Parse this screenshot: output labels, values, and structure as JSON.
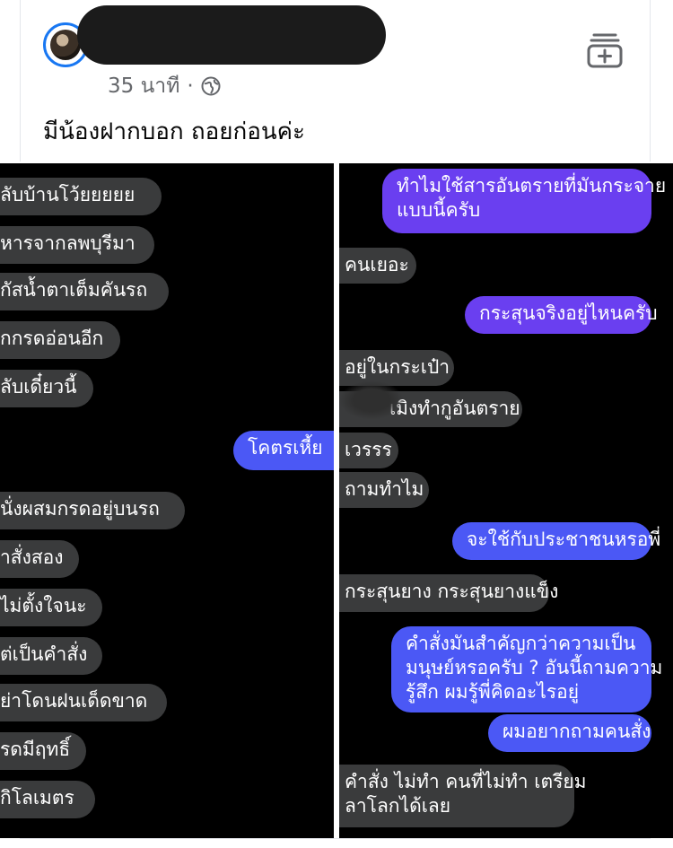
{
  "post": {
    "time": "35 นาที",
    "separator": "·",
    "caption": "มีน้องฝากบอก ถอยก่อนค่ะ"
  },
  "icons": {
    "audience": "globe-icon",
    "save": "save-to-collection-icon"
  },
  "colors": {
    "link_blue": "#1877f2",
    "sent_purple": "#6a3ff0",
    "sent_blue": "#4b58f5",
    "received_gray": "#3a3b3c",
    "chat_bg": "#000000"
  },
  "left_chat": {
    "messages": [
      {
        "side": "received",
        "text": "ลับบ้านโว้ยยยยย"
      },
      {
        "side": "received",
        "text": "หารจากลพบุรีมา"
      },
      {
        "side": "received",
        "text": "กัสน้ำตาเต็มคันรถ"
      },
      {
        "side": "received",
        "text": "กกรดอ่อนอีก"
      },
      {
        "side": "received",
        "text": "ลับเดี๋ยวนี้"
      },
      {
        "side": "sent",
        "text": "โคตรเหี้ย"
      },
      {
        "side": "received",
        "text": "นั่งผสมกรดอยู่บนรถ"
      },
      {
        "side": "received",
        "text": "าสั่งสอง"
      },
      {
        "side": "received",
        "text": "ไม่ตั้งใจนะ"
      },
      {
        "side": "received",
        "text": "ต่เป็นคำสั่ง"
      },
      {
        "side": "received",
        "text": "ย่าโดนฝนเด็ดขาด"
      },
      {
        "side": "received",
        "text": "รดมีฤทธิ์"
      },
      {
        "side": "received",
        "text": "กิโลเมตร"
      }
    ]
  },
  "right_chat": {
    "messages": [
      {
        "side": "sent",
        "text_lines": [
          "ทำไมใช้สารอันตรายที่มันกระจาย",
          "แบบนี้ครับ"
        ]
      },
      {
        "side": "received",
        "text": "คนเยอะ"
      },
      {
        "side": "sent",
        "text": "กระสุนจริงอยู่ไหนครับ"
      },
      {
        "side": "received",
        "text": "อยู่ในกระเป๋า"
      },
      {
        "side": "received",
        "text": "เมิงทำกูอันตราย"
      },
      {
        "side": "received",
        "text": "เวรรร"
      },
      {
        "side": "received",
        "text": "ถามทำไม"
      },
      {
        "side": "sent",
        "text": "จะใช้กับประชาชนหรอพี่"
      },
      {
        "side": "received",
        "text": "กระสุนยาง กระสุนยางแข็ง"
      },
      {
        "side": "sent",
        "text_lines": [
          "คำสั่งมันสำคัญกว่าความเป็น",
          "มนุษย์หรอครับ ? อันนี้ถามความ",
          "รู้สึก ผมรู้พี่คิดอะไรอยู่"
        ]
      },
      {
        "side": "sent",
        "text": "ผมอยากถามคนสั่ง"
      },
      {
        "side": "received",
        "text_lines": [
          "คำสั่ง ไม่ทำ คนที่ไม่ทำ เตรียม",
          "ลาโลกได้เลย"
        ]
      }
    ]
  }
}
